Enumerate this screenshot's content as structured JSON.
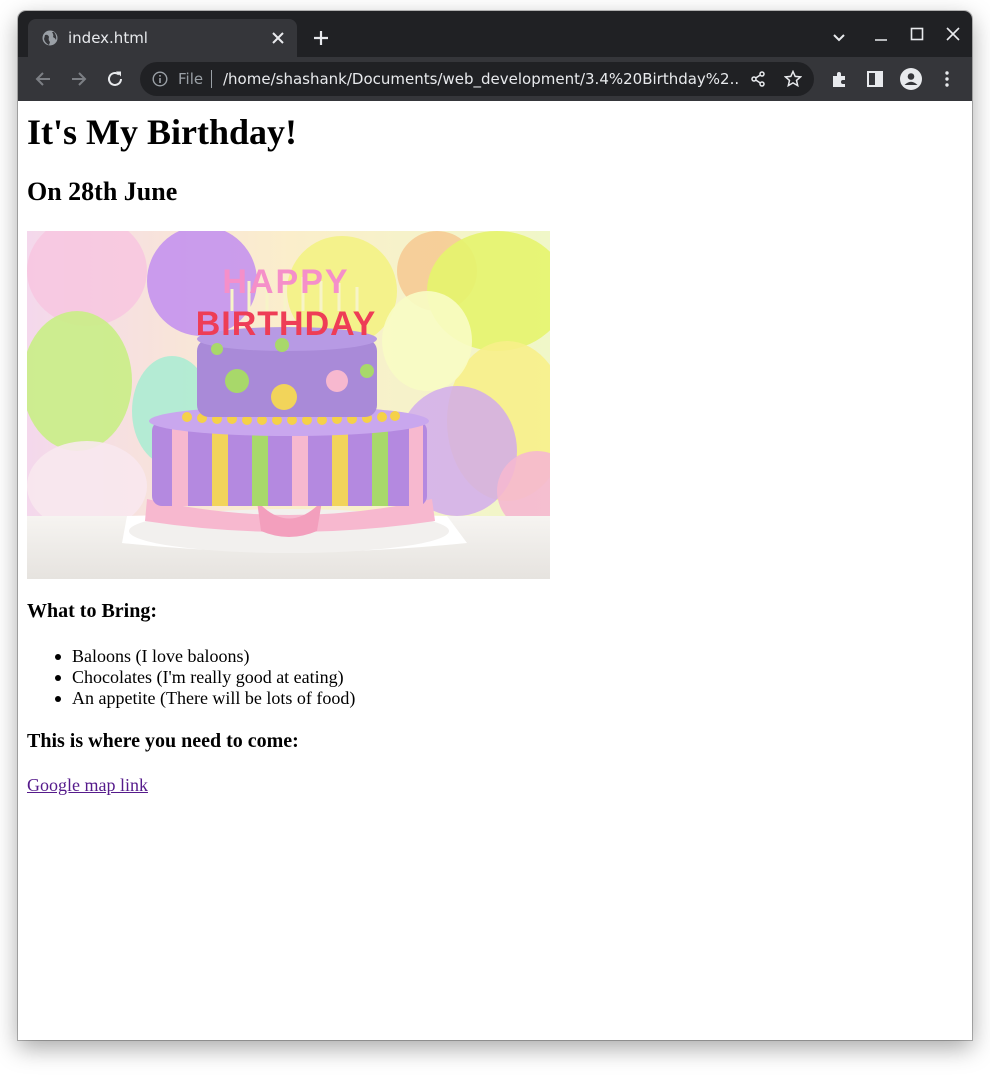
{
  "browser": {
    "tab_title": "index.html",
    "address_scheme": "File",
    "url": "/home/shashank/Documents/web_development/3.4%20Birthday%2..."
  },
  "page": {
    "heading": "It's My Birthday!",
    "date": "On 28th June",
    "cake_image": {
      "cake_topper": [
        "HAPPY",
        "BIRTHDAY"
      ]
    },
    "bring_heading": "What to Bring:",
    "bring_items": [
      "Baloons (I love baloons)",
      "Chocolates (I'm really good at eating)",
      "An appetite (There will be lots of food)"
    ],
    "location_heading": "This is where you need to come:",
    "map_link": "Google map link"
  },
  "colors": {
    "tabstrip": "#202124",
    "toolbar": "#35363a",
    "visited_link": "#551a8b"
  }
}
